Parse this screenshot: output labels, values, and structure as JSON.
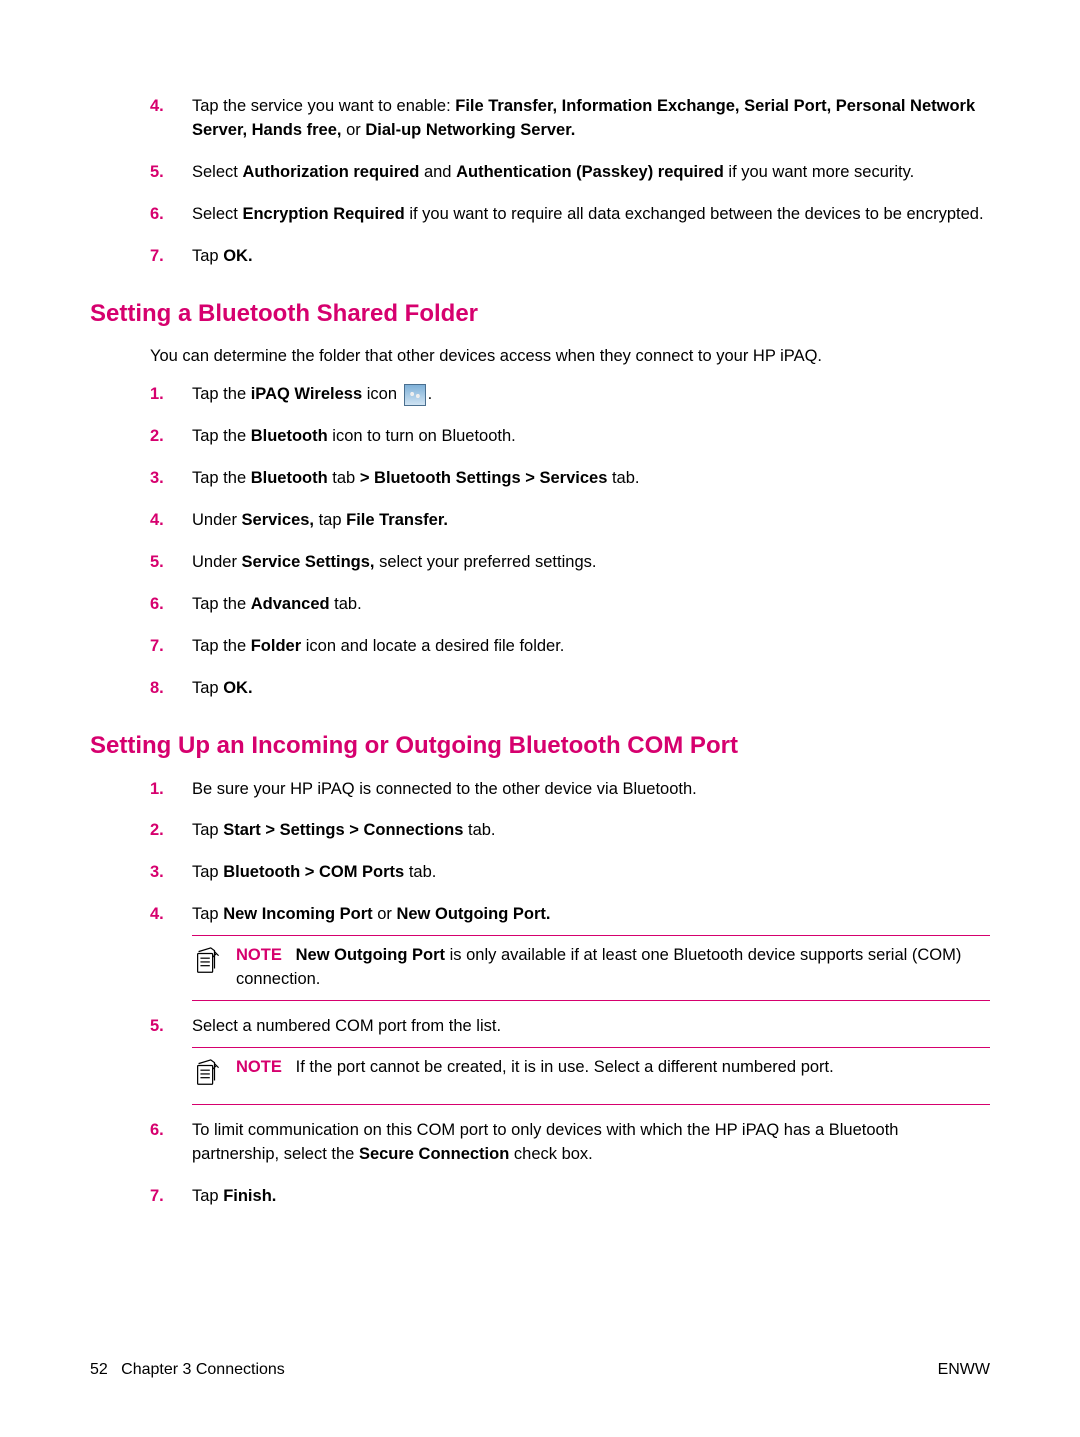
{
  "listA": {
    "items": [
      {
        "num": "4.",
        "prefix": "Tap the service you want to enable: ",
        "bold": "File Transfer, Information Exchange, Serial Port, Personal Network Server, Hands free,",
        "mid": " or ",
        "bold2": "Dial-up Networking Server."
      },
      {
        "num": "5.",
        "prefix": "Select ",
        "bold": "Authorization required",
        "mid": " and ",
        "bold2": "Authentication (Passkey) required",
        "suffix": " if you want more security."
      },
      {
        "num": "6.",
        "prefix": "Select ",
        "bold": "Encryption Required",
        "suffix": " if you want to require all data exchanged between the devices to be encrypted."
      },
      {
        "num": "7.",
        "prefix": "Tap ",
        "bold": "OK."
      }
    ]
  },
  "sectionB": {
    "heading": "Setting a Bluetooth Shared Folder",
    "intro": "You can determine the folder that other devices access when they connect to your HP iPAQ.",
    "items": [
      {
        "num": "1.",
        "prefix": "Tap the ",
        "bold": "iPAQ Wireless",
        "suffix": " icon ",
        "trail": "."
      },
      {
        "num": "2.",
        "prefix": "Tap the ",
        "bold": "Bluetooth",
        "suffix": " icon to turn on Bluetooth."
      },
      {
        "num": "3.",
        "prefix": "Tap the ",
        "bold": "Bluetooth",
        "mid": " tab ",
        "bold2": "> Bluetooth Settings > Services",
        "suffix": " tab."
      },
      {
        "num": "4.",
        "prefix": "Under ",
        "bold": "Services,",
        "mid": " tap ",
        "bold2": "File Transfer."
      },
      {
        "num": "5.",
        "prefix": "Under ",
        "bold": "Service Settings,",
        "suffix": " select your preferred settings."
      },
      {
        "num": "6.",
        "prefix": "Tap the ",
        "bold": "Advanced",
        "suffix": " tab."
      },
      {
        "num": "7.",
        "prefix": "Tap the ",
        "bold": "Folder",
        "suffix": " icon and locate a desired file folder."
      },
      {
        "num": "8.",
        "prefix": "Tap ",
        "bold": "OK."
      }
    ]
  },
  "sectionC": {
    "heading": "Setting Up an Incoming or Outgoing Bluetooth COM Port",
    "items": [
      {
        "num": "1.",
        "plain": "Be sure your HP iPAQ is connected to the other device via Bluetooth."
      },
      {
        "num": "2.",
        "prefix": "Tap ",
        "bold": "Start > Settings > Connections",
        "suffix": " tab."
      },
      {
        "num": "3.",
        "prefix": "Tap ",
        "bold": "Bluetooth > COM Ports",
        "suffix": " tab."
      },
      {
        "num": "4.",
        "prefix": "Tap ",
        "bold": "New Incoming Port",
        "mid": " or ",
        "bold2": "New Outgoing Port."
      },
      {
        "num": "5.",
        "plain": "Select a numbered COM port from the list."
      },
      {
        "num": "6.",
        "plain_pre": "To limit communication on this COM port to only devices with which the HP iPAQ has a Bluetooth partnership, select the ",
        "bold": "Secure Connection",
        "plain_post": " check box."
      },
      {
        "num": "7.",
        "prefix": "Tap ",
        "bold": "Finish."
      }
    ],
    "note1": {
      "label": "NOTE",
      "bold": "New Outgoing Port",
      "text_after": " is only available if at least one Bluetooth device supports serial (COM) connection."
    },
    "note2": {
      "label": "NOTE",
      "text": "If the port cannot be created, it is in use. Select a different numbered port."
    }
  },
  "footer": {
    "left_page": "52",
    "left_chapter": "Chapter 3   Connections",
    "right": "ENWW"
  }
}
